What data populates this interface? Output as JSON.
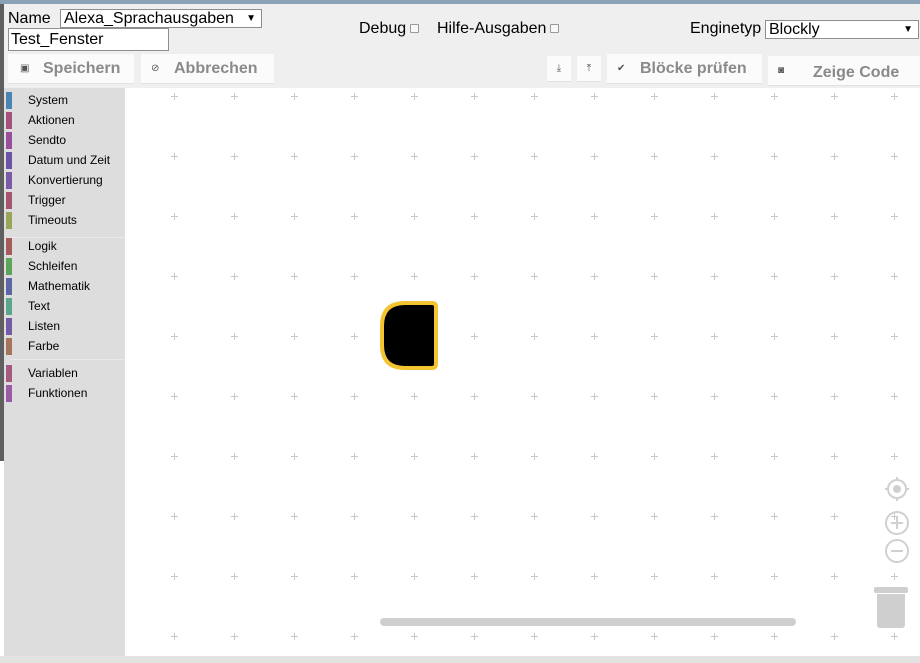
{
  "header": {
    "name_label": "Name",
    "script_select_value": "Alexa_Sprachausgaben",
    "window_name_value": "Test_Fenster",
    "debug_label": "Debug",
    "help_label": "Hilfe-Ausgaben",
    "engine_label": "Enginetyp",
    "engine_select_value": "Blockly"
  },
  "toolbar": {
    "save_label": "Speichern",
    "cancel_label": "Abbrechen",
    "check_label": "Blöcke prüfen",
    "show_code_label": "Zeige Code"
  },
  "toolbox": {
    "categories": [
      {
        "label": "System",
        "color": "#4a84b0"
      },
      {
        "label": "Aktionen",
        "color": "#a4527c"
      },
      {
        "label": "Sendto",
        "color": "#9a4f9a"
      },
      {
        "label": "Datum und Zeit",
        "color": "#6d53a6"
      },
      {
        "label": "Konvertierung",
        "color": "#7d5aa6"
      },
      {
        "label": "Trigger",
        "color": "#a5566e"
      },
      {
        "label": "Timeouts",
        "color": "#9aa55b"
      },
      {
        "label": "Logik",
        "color": "#a55b5b"
      },
      {
        "label": "Schleifen",
        "color": "#5ba55b"
      },
      {
        "label": "Mathematik",
        "color": "#5b67a5"
      },
      {
        "label": "Text",
        "color": "#5ba58c"
      },
      {
        "label": "Listen",
        "color": "#745ba5"
      },
      {
        "label": "Farbe",
        "color": "#a5745b"
      },
      {
        "label": "Variablen",
        "color": "#a55b80"
      },
      {
        "label": "Funktionen",
        "color": "#995ba5"
      }
    ]
  },
  "workspace": {
    "block_fill": "#000000",
    "block_outline": "#f5c431"
  }
}
